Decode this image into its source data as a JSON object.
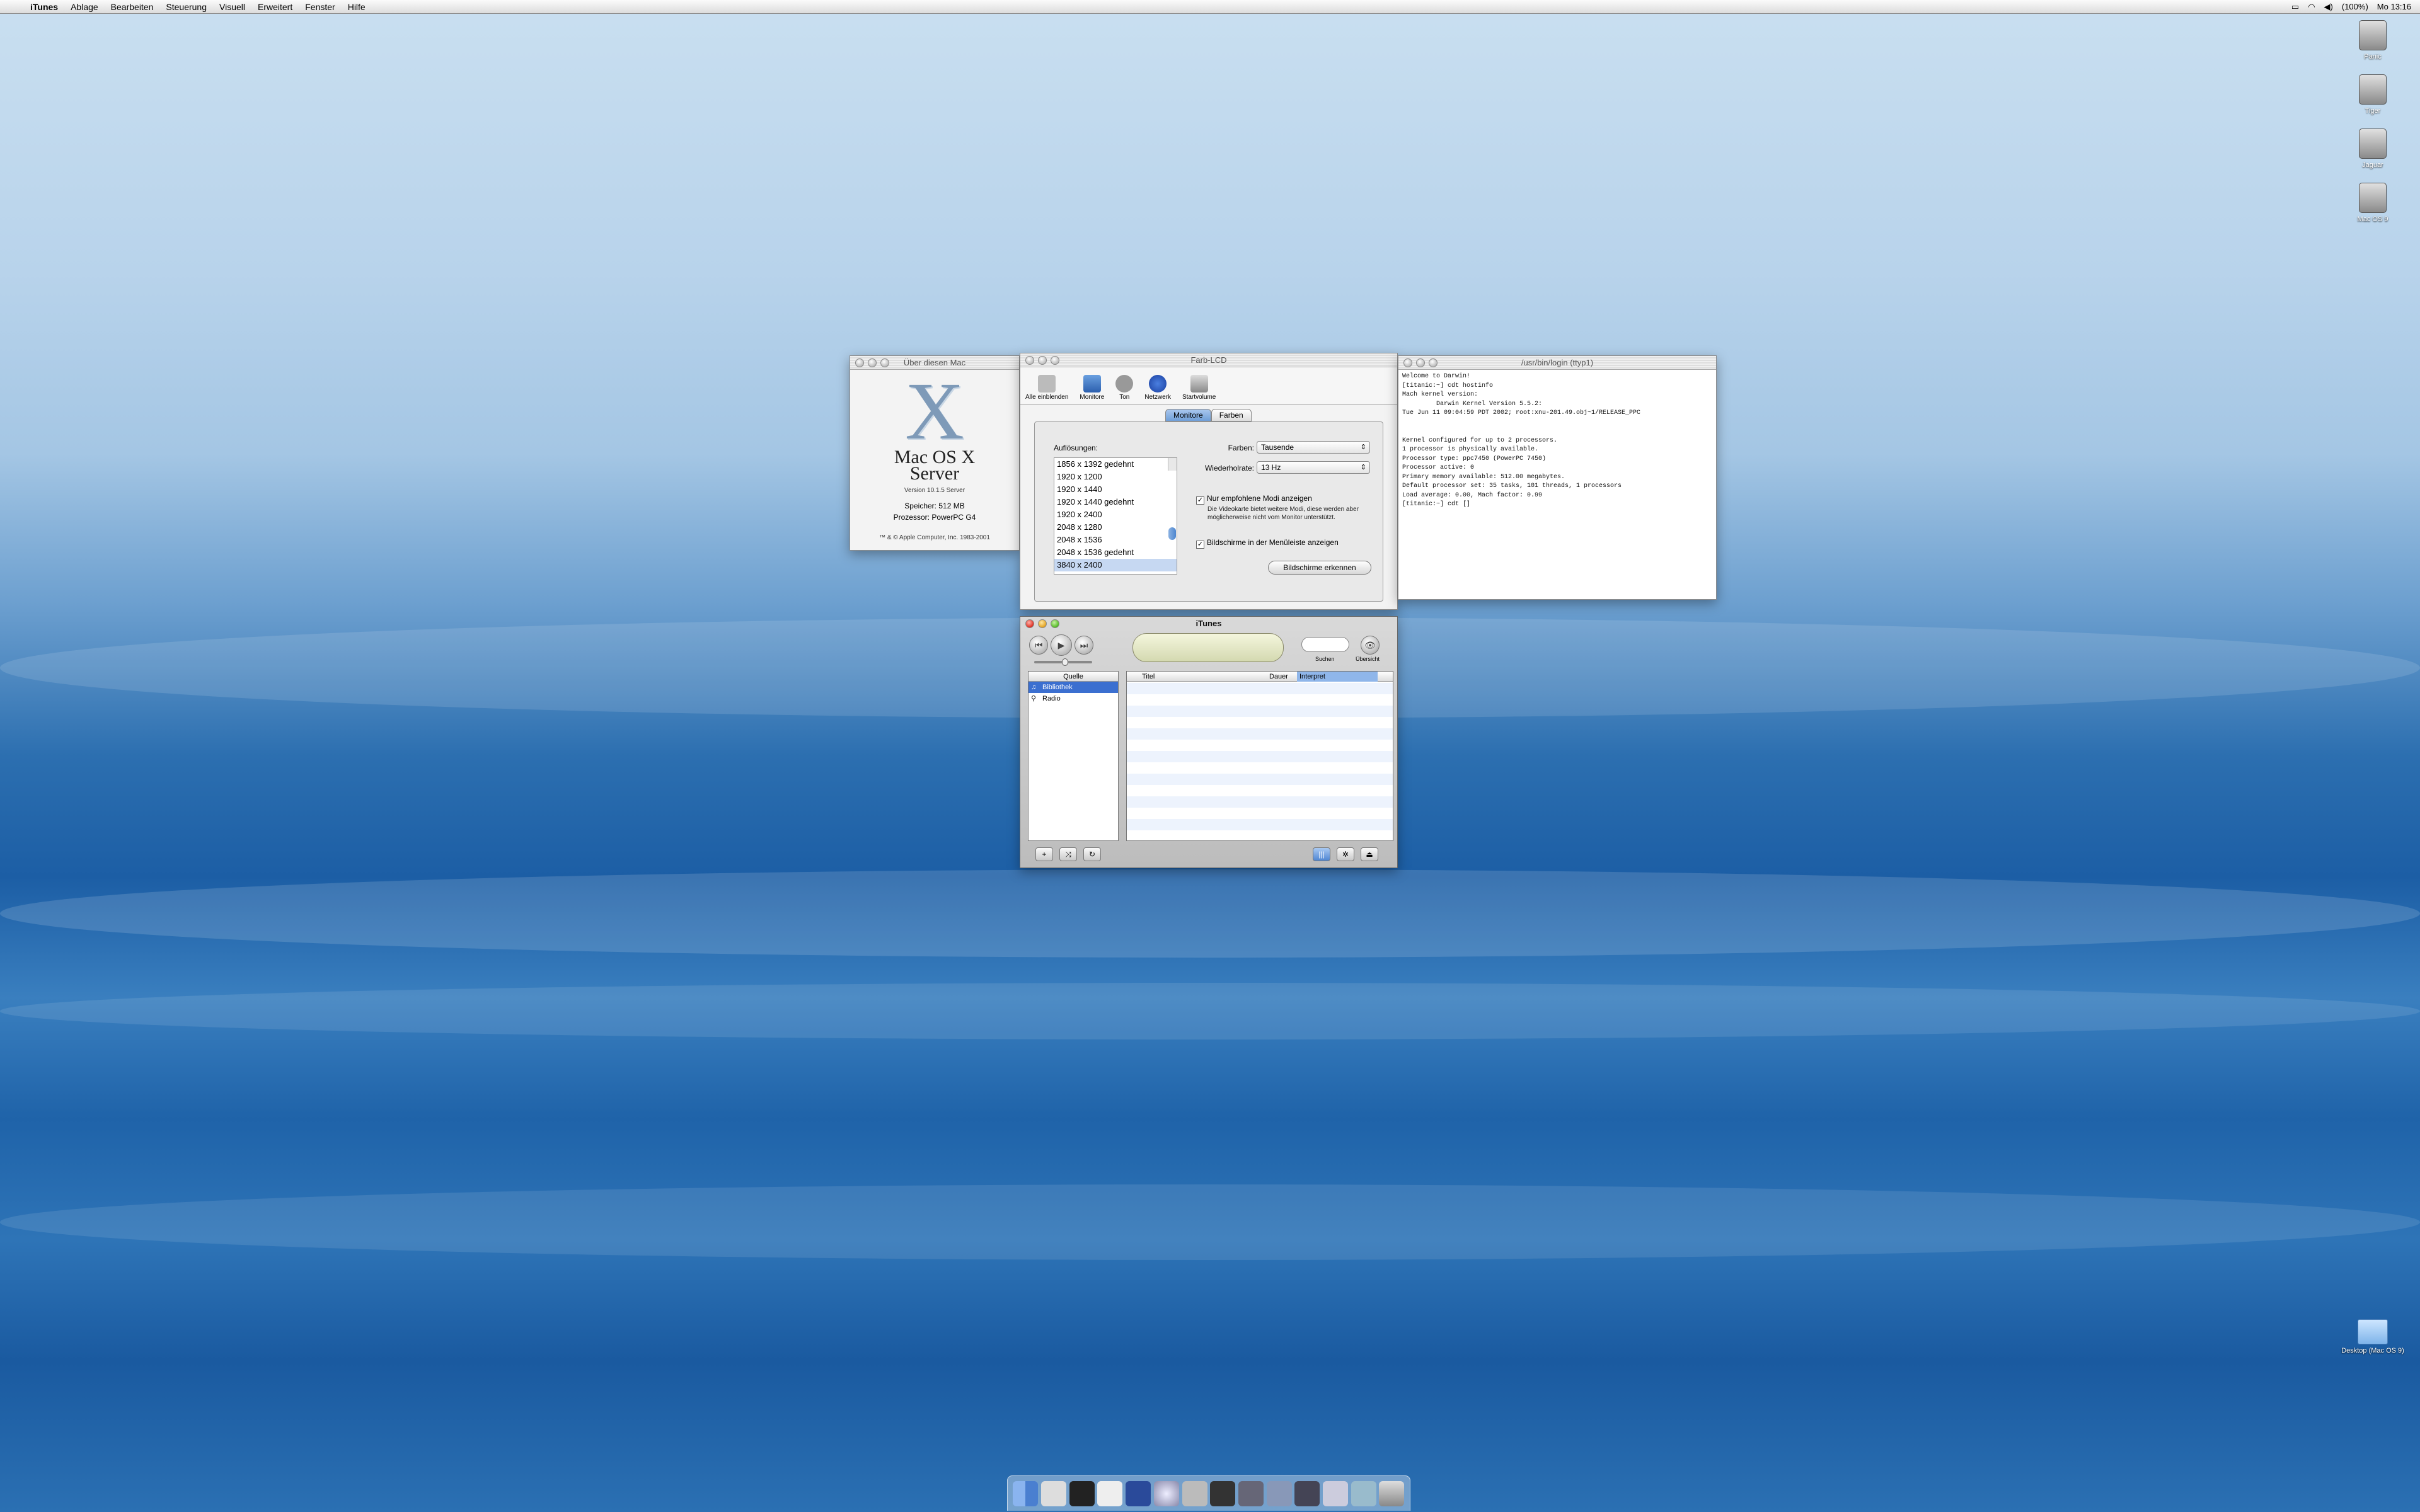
{
  "menubar": {
    "app": "iTunes",
    "items": [
      "Ablage",
      "Bearbeiten",
      "Steuerung",
      "Visuell",
      "Erweitert",
      "Fenster",
      "Hilfe"
    ],
    "battery": "(100%)",
    "clock": "Mo 13:16"
  },
  "about": {
    "title": "Über diesen Mac",
    "logo_letter": "X",
    "os_line1": "Mac OS X",
    "os_line2": "Server",
    "version": "Version 10.1.5 Server",
    "memory_label": "Speicher:",
    "memory_value": "512 MB",
    "cpu_label": "Prozessor:",
    "cpu_value": "PowerPC G4",
    "copyright": "™ & © Apple Computer, Inc. 1983-2001"
  },
  "prefs": {
    "title": "Farb-LCD",
    "toolbar": [
      "Alle einblenden",
      "Monitore",
      "Ton",
      "Netzwerk",
      "Startvolume"
    ],
    "tabs": [
      "Monitore",
      "Farben"
    ],
    "resolutions_label": "Auflösungen:",
    "resolutions": [
      "1856 x 1392 gedehnt",
      "1920 x 1200",
      "1920 x 1440",
      "1920 x 1440 gedehnt",
      "1920 x 2400",
      "2048 x 1280",
      "2048 x 1536",
      "2048 x 1536 gedehnt",
      "3840 x 2400"
    ],
    "selected_resolution": "3840 x 2400",
    "colors_label": "Farben:",
    "colors_value": "Tausende",
    "refresh_label": "Wiederholrate:",
    "refresh_value": "13 Hz",
    "check_recommended": "Nur empfohlene Modi anzeigen",
    "recommended_note": "Die Videokarte bietet weitere Modi, diese werden aber möglicherweise nicht vom Monitor unterstützt.",
    "check_menubar": "Bildschirme in der Menüleiste anzeigen",
    "detect_button": "Bildschirme erkennen"
  },
  "terminal": {
    "title": "/usr/bin/login  (ttyp1)",
    "text": "Welcome to Darwin!\n[titanic:~] cdt hostinfo\nMach kernel version:\n         Darwin Kernel Version 5.5.2:\nTue Jun 11 09:04:59 PDT 2002; root:xnu-201.49.obj~1/RELEASE_PPC\n\n\nKernel configured for up to 2 processors.\n1 processor is physically available.\nProcessor type: ppc7450 (PowerPC 7450)\nProcessor active: 0\nPrimary memory available: 512.00 megabytes.\nDefault processor set: 35 tasks, 101 threads, 1 processors\nLoad average: 0.00, Mach factor: 0.99\n[titanic:~] cdt []"
  },
  "itunes": {
    "title": "iTunes",
    "search_label": "Suchen",
    "browse_label": "Übersicht",
    "source_header": "Quelle",
    "sources": [
      "Bibliothek",
      "Radio"
    ],
    "col_title": "Titel",
    "col_duration": "Dauer",
    "col_artist": "Interpret"
  },
  "desktop": {
    "icons": [
      "Panic",
      "Tiger",
      "Jaguar",
      "Mac OS 9"
    ],
    "folder": "Desktop (Mac OS 9)"
  }
}
